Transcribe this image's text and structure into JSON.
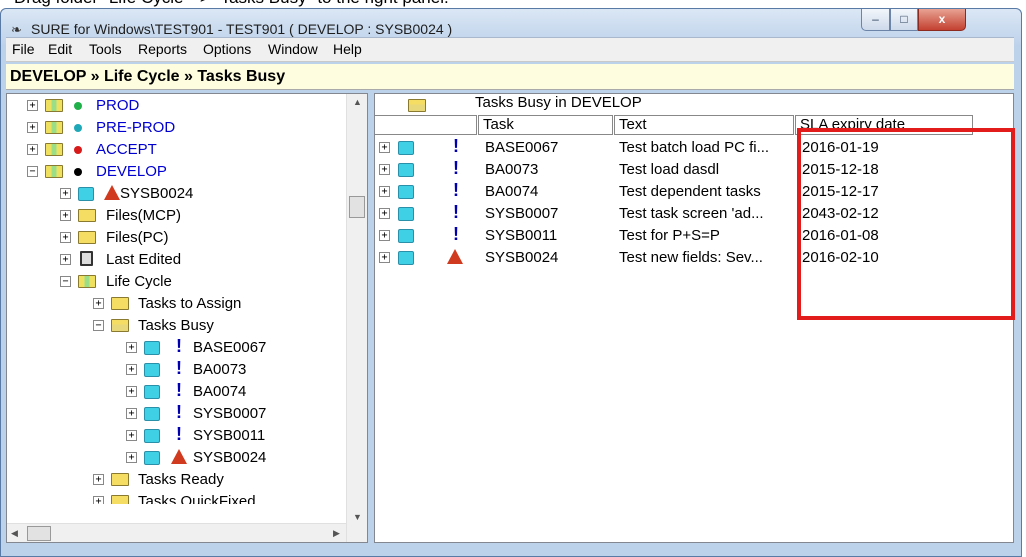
{
  "caption": "Drag folder \"Life Cycle\" -> \"Tasks Busy\" to the right panel.",
  "window": {
    "title": "SURE for Windows\\TEST901 - TEST901 ( DEVELOP : SYSB0024 )",
    "controls": {
      "minimize": "–",
      "maximize": "□",
      "close": "x"
    }
  },
  "menu": [
    "File",
    "Edit",
    "Tools",
    "Reports",
    "Options",
    "Window",
    "Help"
  ],
  "breadcrumb": "DEVELOP » Life Cycle » Tasks Busy",
  "tree": [
    {
      "label": "PROD",
      "icon": "lifecycle-folder-icon",
      "status_color": "#1fb04a"
    },
    {
      "label": "PRE-PROD",
      "icon": "lifecycle-folder-icon",
      "status_color": "#1fa8b8"
    },
    {
      "label": "ACCEPT",
      "icon": "lifecycle-folder-icon",
      "status_color": "#d81a1a"
    },
    {
      "label": "DEVELOP",
      "icon": "lifecycle-folder-icon",
      "status_color": "#000000"
    },
    {
      "label": "SYSB0024",
      "icon": "task-bucket-icon"
    },
    {
      "label": "Files(MCP)",
      "icon": "folder-icon"
    },
    {
      "label": "Files(PC)",
      "icon": "folder-icon"
    },
    {
      "label": "Last Edited",
      "icon": "edit-icon"
    },
    {
      "label": "Life Cycle",
      "icon": "lifecycle-folder-icon"
    },
    {
      "label": "Tasks to Assign",
      "icon": "folder-icon"
    },
    {
      "label": "Tasks Busy",
      "icon": "open-folder-icon"
    },
    {
      "label": "BASE0067",
      "icon": "task-bucket-icon"
    },
    {
      "label": "BA0073",
      "icon": "task-bucket-icon"
    },
    {
      "label": "BA0074",
      "icon": "task-bucket-icon"
    },
    {
      "label": "SYSB0007",
      "icon": "task-bucket-icon"
    },
    {
      "label": "SYSB0011",
      "icon": "task-bucket-icon"
    },
    {
      "label": "SYSB0024",
      "icon": "task-bucket-icon"
    },
    {
      "label": "Tasks Ready",
      "icon": "folder-icon"
    },
    {
      "label": "Tasks QuickFixed",
      "icon": "folder-icon"
    }
  ],
  "grid": {
    "title": "Tasks Busy  in DEVELOP",
    "columns": [
      "Task",
      "Text",
      "SLA expiry date"
    ],
    "rows": [
      {
        "task": "BASE0067",
        "text": "Test batch load PC fi...",
        "sla": "2016-01-19",
        "status": "exclamation"
      },
      {
        "task": "BA0073",
        "text": "Test load dasdl",
        "sla": "2015-12-18",
        "status": "exclamation"
      },
      {
        "task": "BA0074",
        "text": "Test dependent tasks",
        "sla": "2015-12-17",
        "status": "exclamation"
      },
      {
        "task": "SYSB0007",
        "text": "Test task screen 'ad...",
        "sla": "2043-02-12",
        "status": "exclamation"
      },
      {
        "task": "SYSB0011",
        "text": "Test for P+S=P",
        "sla": "2016-01-08",
        "status": "exclamation"
      },
      {
        "task": "SYSB0024",
        "text": "Test new fields: Sev...",
        "sla": "2016-02-10",
        "status": "warning"
      }
    ]
  },
  "colors": {
    "highlight": "#e21b1b",
    "breadcrumb_bg": "#fffde0",
    "tree_blue_text": "#0000d0"
  }
}
